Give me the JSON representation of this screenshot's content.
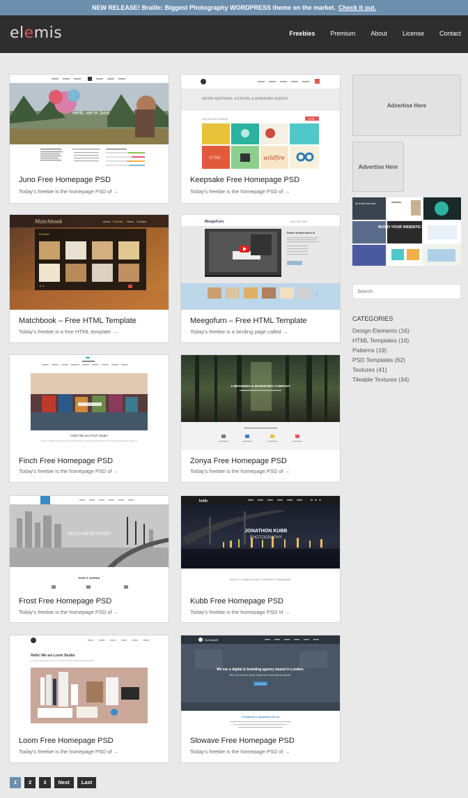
{
  "announcement": {
    "text": "NEW RELEASE! Braille: Biggest Photography WORDPRESS theme on the market.",
    "link": "Check it out."
  },
  "brand": {
    "logo_pre": "el",
    "logo_accent": "e",
    "logo_post": "mis"
  },
  "nav": [
    "Freebies",
    "Premium",
    "About",
    "License",
    "Contact"
  ],
  "cards": [
    {
      "title": "Juno Free Homepage PSD",
      "sub": "Today's freebie is the homepage PSD of →"
    },
    {
      "title": "Keepsake Free Homepage PSD",
      "sub": "Today's freebie is the homepage PSD of →"
    },
    {
      "title": "Matchbook – Free HTML Template",
      "sub": "Today's freebie is a free HTML template →"
    },
    {
      "title": "Meegofurn – Free HTML Template",
      "sub": "Today's freebie is a landing page called →"
    },
    {
      "title": "Finch Free Homepage PSD",
      "sub": "Today's freebie is the homepage PSD of →"
    },
    {
      "title": "Zonya Free Homepage PSD",
      "sub": "Today's freebie is the homepage PSD of →"
    },
    {
      "title": "Frost Free Homepage PSD",
      "sub": "Today's freebie is the homepage PSD of →"
    },
    {
      "title": "Kubb Free Homepage PSD",
      "sub": "Today's freebie is the homepage PSD of →"
    },
    {
      "title": "Loom Free Homepage PSD",
      "sub": "Today's freebie is the homepage PSD of →"
    },
    {
      "title": "Slowave Free Homepage PSD",
      "sub": "Today's freebie is the homepage PSD of →"
    }
  ],
  "thumbs": {
    "juno": {
      "nav": "Hello, we're Juno"
    },
    "keepsake": {
      "tagline": "WE'RE KEEPSAKE. A DIGITAL & BRANDING AGENCY",
      "section": "OUR RECENT WORKS",
      "badge": "MORE",
      "stamp_word": "STAW",
      "script_word": "wildfire"
    },
    "matchbook": {
      "logo": "Matchbook",
      "nav": [
        "About",
        "Portfolio",
        "News",
        "Contact"
      ],
      "heading": "Portfolio"
    },
    "meegofurn": {
      "logo": "MeegoFurn.",
      "phone": "(123) 756 78 56",
      "heading": "Donec sit amet lacus id"
    },
    "finch": {
      "line1": "Hello! We are Finch Studio",
      "line2": "We are a digital photography studio specializing in landscape, advertorial and conceptual photography, based in"
    },
    "zonya": {
      "heading": "A BRANDING & MARKETING COMPANY"
    },
    "frost": {
      "heading": "HELLO WE'RE FROST",
      "section": "HOW IT WORKS"
    },
    "kubb": {
      "logo": "kubb",
      "line1": "JONATHON KUBB",
      "line2": "PHOTOGRAPHY",
      "intro": "Hello! I'm Jonathon Kubb, a freelance Photographer."
    },
    "loom": {
      "heading": "Hello! We are Loom Studio",
      "sub": "a creative homepage but from their top of creative ideas and great design"
    },
    "slowave": {
      "logo": "SLOWAVE",
      "heading": "We are a digital & branding agency based in London.",
      "sub": "We love to turn great ideas into beautiful products.",
      "cta": "LEARN MORE",
      "section": "Creativity is important for us"
    }
  },
  "sidebar": {
    "ad1": "Advertise Here",
    "ad2": "Advertise Here",
    "banner_text": "BUILD YOUR WEBSITE NOW",
    "banner_top": "all of bold and new",
    "search_placeholder": "Search",
    "categories_heading": "CATEGORIES",
    "categories": [
      "Design Elements (16)",
      "HTML Templates (16)",
      "Patterns (19)",
      "PSD Templates (62)",
      "Textures (41)",
      "Tileable Textures (34)"
    ]
  },
  "pagination": [
    "1",
    "2",
    "3",
    "Next",
    "Last"
  ]
}
